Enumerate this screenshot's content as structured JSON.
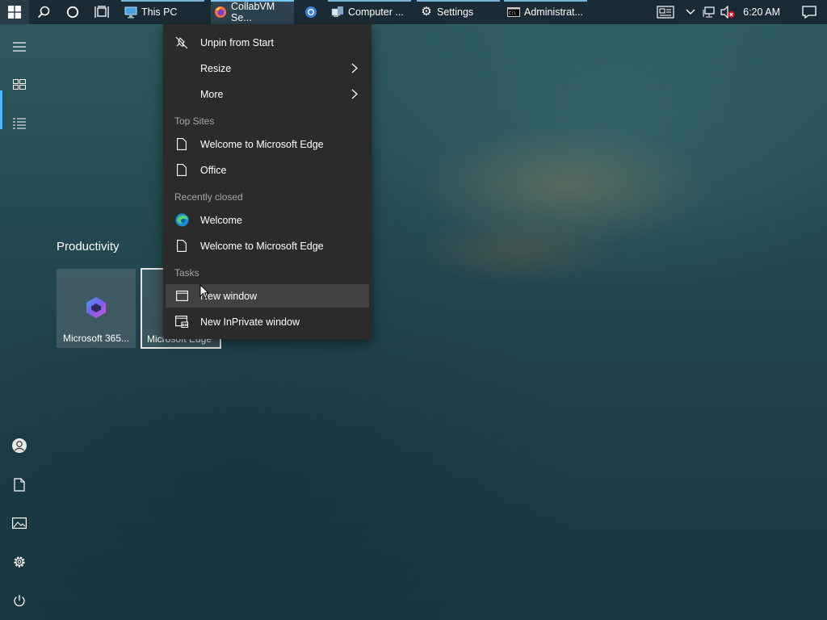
{
  "taskbar": {
    "buttons": [
      {
        "label": "This PC"
      },
      {
        "label": "CollabVM Se..."
      },
      {
        "label": "Computer ..."
      },
      {
        "label": "Settings"
      },
      {
        "label": "Administrat..."
      }
    ],
    "clock": "6:20 AM"
  },
  "start": {
    "group_title": "Productivity",
    "tiles": [
      {
        "label": "Microsoft 365..."
      },
      {
        "label": "Microsoft Edge"
      }
    ]
  },
  "context_menu": {
    "items": [
      {
        "label": "Unpin from Start"
      },
      {
        "label": "Resize"
      },
      {
        "label": "More"
      }
    ],
    "top_sites_header": "Top Sites",
    "top_sites": [
      {
        "label": "Welcome to Microsoft Edge"
      },
      {
        "label": "Office"
      }
    ],
    "recently_closed_header": "Recently closed",
    "recently_closed": [
      {
        "label": "Welcome"
      },
      {
        "label": "Welcome to Microsoft Edge"
      }
    ],
    "tasks_header": "Tasks",
    "tasks": [
      {
        "label": "New window"
      },
      {
        "label": "New InPrivate window"
      }
    ]
  },
  "colors": {
    "taskbar": "#1b2b35",
    "menu_bg": "#2b2b2b",
    "menu_hover": "#414141",
    "accent": "#4fb3ff"
  }
}
